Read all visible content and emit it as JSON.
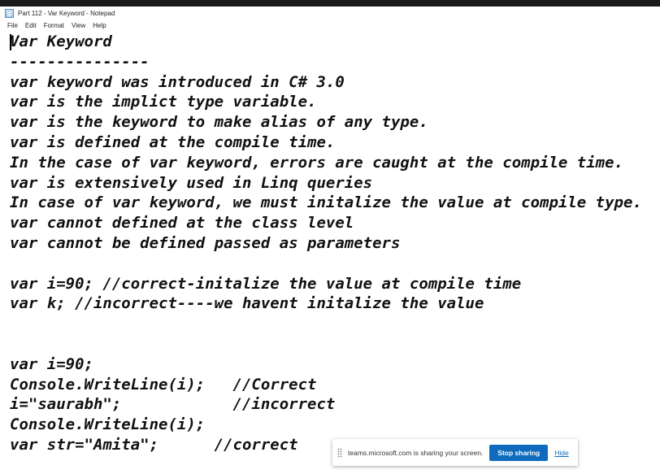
{
  "window": {
    "title": "Part 112 - Var Keyword - Notepad",
    "app_icon": "notepad-icon"
  },
  "menu": [
    "File",
    "Edit",
    "Format",
    "View",
    "Help"
  ],
  "editor": {
    "content": "Var Keyword\n---------------\nvar keyword was introduced in C# 3.0\nvar is the implict type variable.\nvar is the keyword to make alias of any type.\nvar is defined at the compile time.\nIn the case of var keyword, errors are caught at the compile time.\nvar is extensively used in Linq queries\nIn case of var keyword, we must initalize the value at compile type.\nvar cannot defined at the class level\nvar cannot be defined passed as parameters\n\nvar i=90; //correct-initalize the value at compile time\nvar k; //incorrect----we havent initalize the value\n\n\nvar i=90;\nConsole.WriteLine(i);   //Correct\ni=\"saurabh\";            //incorrect\nConsole.WriteLine(i);\nvar str=\"Amita\";      //correct"
  },
  "share_bar": {
    "message": "teams.microsoft.com is sharing your screen.",
    "stop_label": "Stop sharing",
    "hide_label": "Hide",
    "accent": "#0f6cbd"
  }
}
